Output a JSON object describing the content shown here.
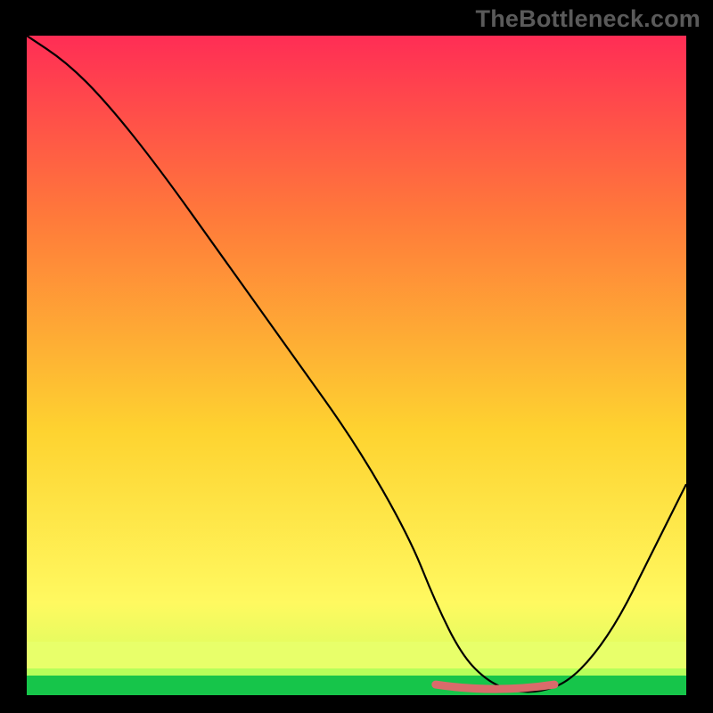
{
  "watermark": "TheBottleneck.com",
  "colors": {
    "top": "#ff2d55",
    "upper": "#ff7b3a",
    "mid": "#fed330",
    "lower": "#fff960",
    "bottom_band": "#e8ff6a",
    "green": "#16c54a",
    "curve": "#000000",
    "accent": "#d96b6b"
  },
  "chart_data": {
    "type": "line",
    "title": "",
    "xlabel": "",
    "ylabel": "",
    "xlim": [
      0,
      100
    ],
    "ylim": [
      0,
      100
    ],
    "series": [
      {
        "name": "bottleneck-curve",
        "x": [
          0,
          6,
          12,
          20,
          30,
          40,
          50,
          58,
          62,
          66,
          70,
          74,
          78,
          82,
          86,
          90,
          94,
          100
        ],
        "values": [
          100,
          96,
          90,
          80,
          66,
          52,
          38,
          24,
          14,
          6,
          2,
          0.5,
          0.5,
          2,
          6,
          12,
          20,
          32
        ]
      }
    ],
    "accent_segment": {
      "x_start": 62,
      "x_end": 80,
      "y": 0.8
    }
  }
}
